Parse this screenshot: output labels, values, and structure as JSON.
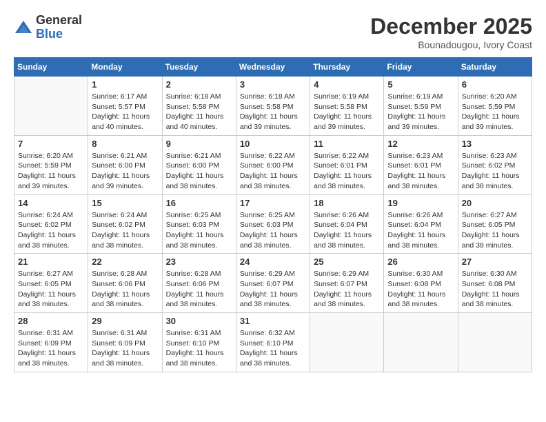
{
  "header": {
    "logo_general": "General",
    "logo_blue": "Blue",
    "month_title": "December 2025",
    "location": "Bounadougou, Ivory Coast"
  },
  "weekdays": [
    "Sunday",
    "Monday",
    "Tuesday",
    "Wednesday",
    "Thursday",
    "Friday",
    "Saturday"
  ],
  "weeks": [
    [
      {
        "day": "",
        "info": ""
      },
      {
        "day": "1",
        "info": "Sunrise: 6:17 AM\nSunset: 5:57 PM\nDaylight: 11 hours\nand 40 minutes."
      },
      {
        "day": "2",
        "info": "Sunrise: 6:18 AM\nSunset: 5:58 PM\nDaylight: 11 hours\nand 40 minutes."
      },
      {
        "day": "3",
        "info": "Sunrise: 6:18 AM\nSunset: 5:58 PM\nDaylight: 11 hours\nand 39 minutes."
      },
      {
        "day": "4",
        "info": "Sunrise: 6:19 AM\nSunset: 5:58 PM\nDaylight: 11 hours\nand 39 minutes."
      },
      {
        "day": "5",
        "info": "Sunrise: 6:19 AM\nSunset: 5:59 PM\nDaylight: 11 hours\nand 39 minutes."
      },
      {
        "day": "6",
        "info": "Sunrise: 6:20 AM\nSunset: 5:59 PM\nDaylight: 11 hours\nand 39 minutes."
      }
    ],
    [
      {
        "day": "7",
        "info": "Sunrise: 6:20 AM\nSunset: 5:59 PM\nDaylight: 11 hours\nand 39 minutes."
      },
      {
        "day": "8",
        "info": "Sunrise: 6:21 AM\nSunset: 6:00 PM\nDaylight: 11 hours\nand 39 minutes."
      },
      {
        "day": "9",
        "info": "Sunrise: 6:21 AM\nSunset: 6:00 PM\nDaylight: 11 hours\nand 38 minutes."
      },
      {
        "day": "10",
        "info": "Sunrise: 6:22 AM\nSunset: 6:00 PM\nDaylight: 11 hours\nand 38 minutes."
      },
      {
        "day": "11",
        "info": "Sunrise: 6:22 AM\nSunset: 6:01 PM\nDaylight: 11 hours\nand 38 minutes."
      },
      {
        "day": "12",
        "info": "Sunrise: 6:23 AM\nSunset: 6:01 PM\nDaylight: 11 hours\nand 38 minutes."
      },
      {
        "day": "13",
        "info": "Sunrise: 6:23 AM\nSunset: 6:02 PM\nDaylight: 11 hours\nand 38 minutes."
      }
    ],
    [
      {
        "day": "14",
        "info": "Sunrise: 6:24 AM\nSunset: 6:02 PM\nDaylight: 11 hours\nand 38 minutes."
      },
      {
        "day": "15",
        "info": "Sunrise: 6:24 AM\nSunset: 6:02 PM\nDaylight: 11 hours\nand 38 minutes."
      },
      {
        "day": "16",
        "info": "Sunrise: 6:25 AM\nSunset: 6:03 PM\nDaylight: 11 hours\nand 38 minutes."
      },
      {
        "day": "17",
        "info": "Sunrise: 6:25 AM\nSunset: 6:03 PM\nDaylight: 11 hours\nand 38 minutes."
      },
      {
        "day": "18",
        "info": "Sunrise: 6:26 AM\nSunset: 6:04 PM\nDaylight: 11 hours\nand 38 minutes."
      },
      {
        "day": "19",
        "info": "Sunrise: 6:26 AM\nSunset: 6:04 PM\nDaylight: 11 hours\nand 38 minutes."
      },
      {
        "day": "20",
        "info": "Sunrise: 6:27 AM\nSunset: 6:05 PM\nDaylight: 11 hours\nand 38 minutes."
      }
    ],
    [
      {
        "day": "21",
        "info": "Sunrise: 6:27 AM\nSunset: 6:05 PM\nDaylight: 11 hours\nand 38 minutes."
      },
      {
        "day": "22",
        "info": "Sunrise: 6:28 AM\nSunset: 6:06 PM\nDaylight: 11 hours\nand 38 minutes."
      },
      {
        "day": "23",
        "info": "Sunrise: 6:28 AM\nSunset: 6:06 PM\nDaylight: 11 hours\nand 38 minutes."
      },
      {
        "day": "24",
        "info": "Sunrise: 6:29 AM\nSunset: 6:07 PM\nDaylight: 11 hours\nand 38 minutes."
      },
      {
        "day": "25",
        "info": "Sunrise: 6:29 AM\nSunset: 6:07 PM\nDaylight: 11 hours\nand 38 minutes."
      },
      {
        "day": "26",
        "info": "Sunrise: 6:30 AM\nSunset: 6:08 PM\nDaylight: 11 hours\nand 38 minutes."
      },
      {
        "day": "27",
        "info": "Sunrise: 6:30 AM\nSunset: 6:08 PM\nDaylight: 11 hours\nand 38 minutes."
      }
    ],
    [
      {
        "day": "28",
        "info": "Sunrise: 6:31 AM\nSunset: 6:09 PM\nDaylight: 11 hours\nand 38 minutes."
      },
      {
        "day": "29",
        "info": "Sunrise: 6:31 AM\nSunset: 6:09 PM\nDaylight: 11 hours\nand 38 minutes."
      },
      {
        "day": "30",
        "info": "Sunrise: 6:31 AM\nSunset: 6:10 PM\nDaylight: 11 hours\nand 38 minutes."
      },
      {
        "day": "31",
        "info": "Sunrise: 6:32 AM\nSunset: 6:10 PM\nDaylight: 11 hours\nand 38 minutes."
      },
      {
        "day": "",
        "info": ""
      },
      {
        "day": "",
        "info": ""
      },
      {
        "day": "",
        "info": ""
      }
    ]
  ]
}
